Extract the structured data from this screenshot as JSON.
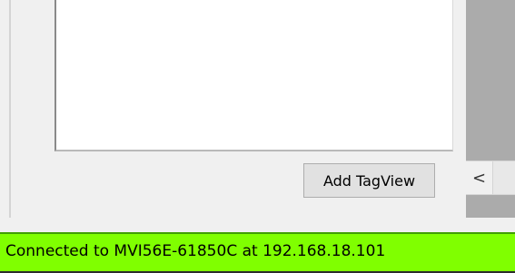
{
  "buttons": {
    "add_tagview": "Add TagView"
  },
  "scrollbar": {
    "left_arrow": "<"
  },
  "status_bar": {
    "text": "Connected to MVI56E-61850C at 192.168.18.101",
    "color": "#80ff00"
  }
}
